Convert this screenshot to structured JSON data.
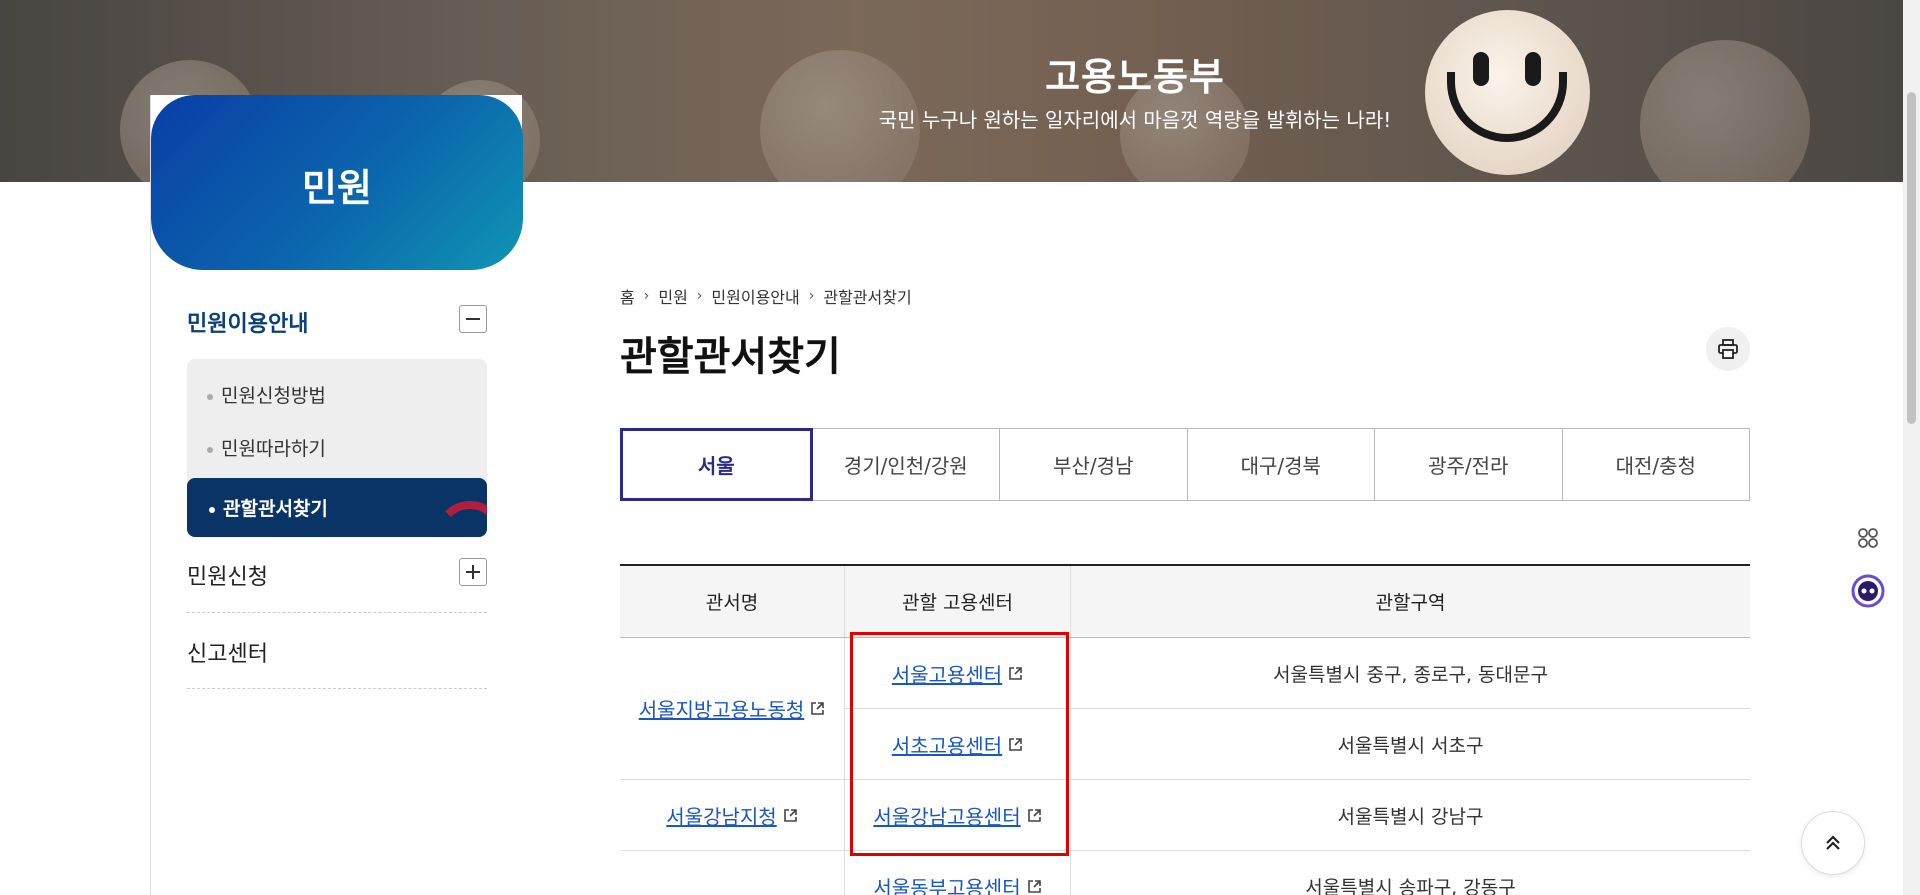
{
  "hero": {
    "title": "고용노동부",
    "subtitle": "국민 누구나 원하는 일자리에서 마음껏 역량을 발휘하는 나라!"
  },
  "sidebar": {
    "title": "민원",
    "groups": [
      {
        "label": "민원이용안내",
        "expanded": true,
        "items": [
          {
            "label": "민원신청방법"
          },
          {
            "label": "민원따라하기"
          },
          {
            "label": "관할관서찾기",
            "active": true
          }
        ]
      },
      {
        "label": "민원신청",
        "expanded": false
      },
      {
        "label": "신고센터"
      }
    ]
  },
  "breadcrumb": [
    "홈",
    "민원",
    "민원이용안내",
    "관할관서찾기"
  ],
  "page_title": "관할관서찾기",
  "tabs": [
    {
      "label": "서울",
      "active": true
    },
    {
      "label": "경기/인천/강원"
    },
    {
      "label": "부산/경남"
    },
    {
      "label": "대구/경북"
    },
    {
      "label": "광주/전라"
    },
    {
      "label": "대전/충청"
    }
  ],
  "table": {
    "headers": [
      "관서명",
      "관할 고용센터",
      "관할구역"
    ],
    "offices": [
      {
        "name": "서울지방고용노동청"
      },
      {
        "name": "서울강남지청"
      }
    ],
    "rows": [
      {
        "center": "서울고용센터",
        "area": "서울특별시 중구, 종로구, 동대문구"
      },
      {
        "center": "서초고용센터",
        "area": "서울특별시 서초구"
      },
      {
        "center": "서울강남고용센터",
        "area": "서울특별시 강남구"
      },
      {
        "center": "서울동부고용센터",
        "area": "서울특별시 송파구, 강동구"
      }
    ]
  },
  "colors": {
    "sidebar_header_start": "#0a3ea6",
    "sidebar_header_end": "#1095b3",
    "active_nav_bg": "#0a3465",
    "active_tab": "#2b2a8a",
    "link": "#1a56c4",
    "highlight": "#e00000"
  },
  "icons": {
    "print": "printer-icon",
    "external": "external-link-icon",
    "top": "double-chevron-up-icon"
  }
}
